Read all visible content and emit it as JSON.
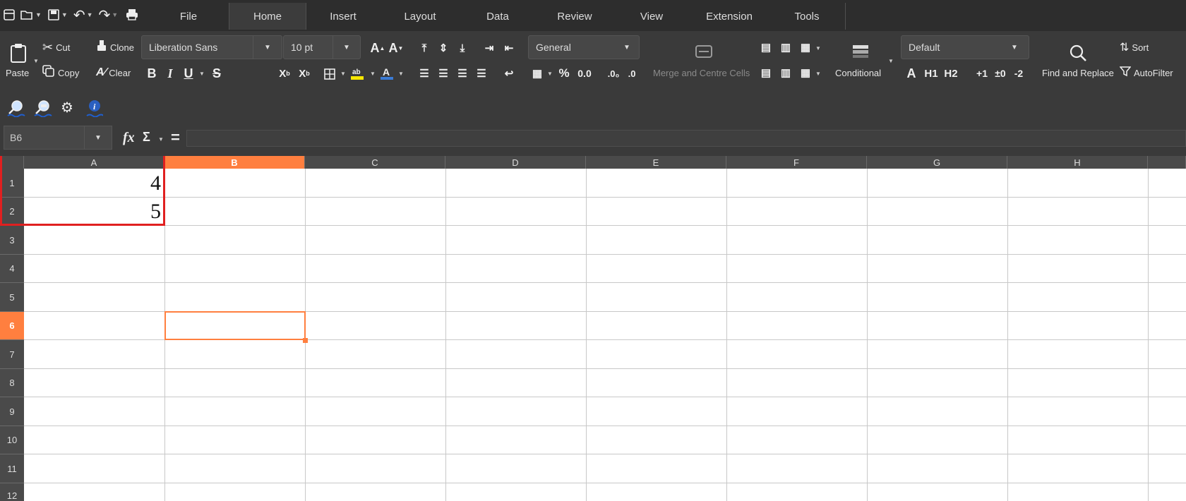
{
  "menu_tabs": [
    "File",
    "Home",
    "Insert",
    "Layout",
    "Data",
    "Review",
    "View",
    "Extension",
    "Tools"
  ],
  "active_tab": "Home",
  "toolbar": {
    "paste_label": "Paste",
    "cut_label": "Cut",
    "copy_label": "Copy",
    "clone_label": "Clone",
    "clear_label": "Clear",
    "font_name": "Liberation Sans",
    "font_size": "10 pt",
    "number_format": "General",
    "merge_label": "Merge and Centre Cells",
    "conditional_label": "Conditional",
    "cell_style": "Default",
    "find_replace_label": "Find and Replace",
    "sort_label": "Sort",
    "autofilter_label": "AutoFilter",
    "percent_symbol": "%",
    "decimal_label": "0.0",
    "h1_label": "H1",
    "h2_label": "H2",
    "plus1_label": "+1",
    "pm0_label": "±0",
    "minus2_label": "-2"
  },
  "formula_bar": {
    "cell_reference": "B6",
    "formula_value": ""
  },
  "grid": {
    "columns": [
      "A",
      "B",
      "C",
      "D",
      "E",
      "F",
      "G",
      "H"
    ],
    "rows": [
      "1",
      "2",
      "3",
      "4",
      "5",
      "6",
      "7",
      "8",
      "9",
      "10",
      "11",
      "12"
    ],
    "selected_column": "B",
    "selected_row": "6",
    "cells": {
      "A1": "4",
      "A2": "5"
    }
  },
  "colors": {
    "accent": "#ff7f3f",
    "highlight_box": "#e02020"
  }
}
